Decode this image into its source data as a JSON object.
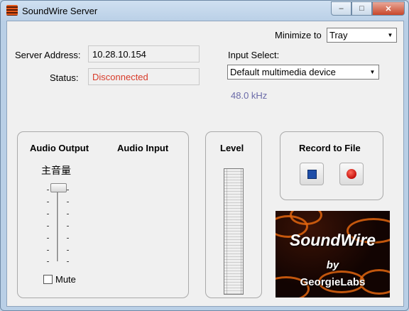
{
  "window": {
    "title": "SoundWire Server",
    "min_glyph": "–",
    "max_glyph": "□",
    "close_glyph": "✕"
  },
  "minimize_to": {
    "label": "Minimize to",
    "value": "Tray"
  },
  "server": {
    "address_label": "Server Address:",
    "address_value": "10.28.10.154",
    "status_label": "Status:",
    "status_value": "Disconnected",
    "status_color": "#d83b2a"
  },
  "input": {
    "label": "Input Select:",
    "value": "Default multimedia device",
    "sample_rate": "48.0 kHz",
    "sample_rate_color": "#6a6aa8"
  },
  "audio": {
    "output_label": "Audio Output",
    "input_label": "Audio Input",
    "volume_label": "主音量",
    "volume_level": 0.97,
    "mute_label": "Mute",
    "muted": false
  },
  "level": {
    "title": "Level",
    "value": 0
  },
  "record": {
    "title": "Record to File",
    "stop_icon": "stop-icon",
    "record_icon": "record-icon"
  },
  "logo": {
    "line1": "SoundWire",
    "line2": "by",
    "line3": "GeorgieLabs"
  }
}
